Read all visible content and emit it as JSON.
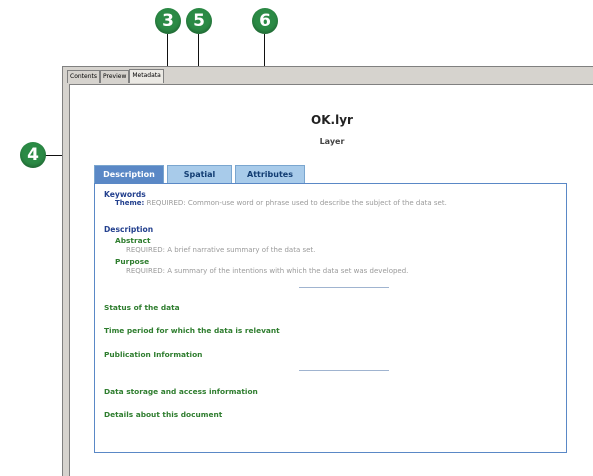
{
  "callouts": {
    "c3": "3",
    "c4": "4",
    "c5": "5",
    "c6": "6"
  },
  "window_tabs": [
    "Contents",
    "Preview",
    "Metadata"
  ],
  "document": {
    "title": "OK.lyr",
    "subtitle": "Layer"
  },
  "metadata_tabs": [
    "Description",
    "Spatial",
    "Attributes"
  ],
  "sections": {
    "keywords": {
      "heading": "Keywords",
      "theme_label": "Theme:",
      "theme_text": "REQUIRED: Common-use word or phrase used to describe the subject of the data set."
    },
    "description": {
      "heading": "Description",
      "abstract_label": "Abstract",
      "abstract_text": "REQUIRED: A brief narrative summary of the data set.",
      "purpose_label": "Purpose",
      "purpose_text": "REQUIRED: A summary of the intentions with which the data set was developed."
    },
    "links": {
      "status": "Status of the data",
      "time_period": "Time period for which the data is relevant",
      "publication": "Publication Information",
      "storage": "Data storage and access information",
      "details": "Details about this document"
    }
  },
  "colors": {
    "callout": "#2b8a45",
    "active_tab": "#5a88c6",
    "inactive_tab": "#a8cbea",
    "heading_blue": "#23408e",
    "link_green": "#2e7d2e"
  }
}
